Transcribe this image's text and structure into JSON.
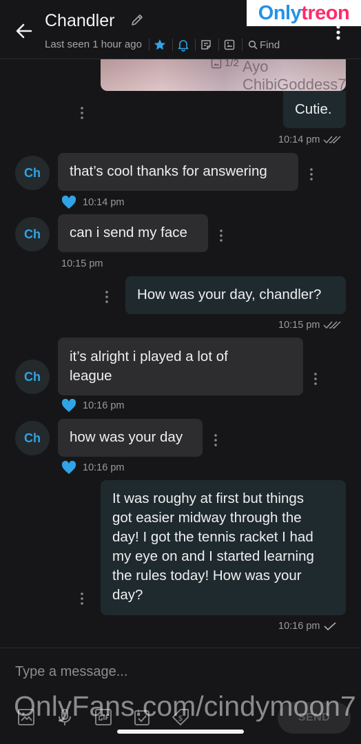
{
  "header": {
    "contact_name": "Chandler",
    "last_seen": "Last seen 1 hour ago",
    "find_label": "Find"
  },
  "watermarks": {
    "top_part1": "Only",
    "top_part2": "treon",
    "bottom": "OnlyFans.com/cindymoon7"
  },
  "colors": {
    "accent": "#2fa4e7",
    "incoming_bubble": "#2d2d2f",
    "outgoing_bubble": "#1f2a2f",
    "background": "#161618"
  },
  "photo": {
    "counter": "1/2",
    "handle": "Ayo ChibiGoddess7"
  },
  "messages": [
    {
      "direction": "out",
      "text": "Cutie.",
      "time": "10:14 pm",
      "status_icon": "double-check-icon"
    },
    {
      "direction": "in",
      "avatar": "Ch",
      "text": "that’s cool thanks for answering",
      "time": "10:14 pm",
      "liked": true
    },
    {
      "direction": "in",
      "avatar": "Ch",
      "text": "can i send my face",
      "time": "10:15 pm",
      "liked": false
    },
    {
      "direction": "out",
      "text": "How was your day, chandler?",
      "time": "10:15 pm",
      "status_icon": "double-check-icon"
    },
    {
      "direction": "in",
      "avatar": "Ch",
      "text_lines": [
        "it’s alright i played a lot of",
        "league"
      ],
      "time": "10:16 pm",
      "liked": true
    },
    {
      "direction": "in",
      "avatar": "Ch",
      "text": "how was your day",
      "time": "10:16 pm",
      "liked": true
    },
    {
      "direction": "out",
      "text_lines": [
        "It was roughy at first but things",
        "got easier midway through the",
        "day! I got the tennis racket I had",
        "my eye on and I started learning",
        "the rules today! How was your",
        "day?"
      ],
      "time": "10:16 pm",
      "status_icon": "check-icon"
    }
  ],
  "composer": {
    "placeholder": "Type a message...",
    "send_label": "SEND",
    "tools": [
      "image-icon",
      "microphone-icon",
      "gif-icon",
      "checklist-icon",
      "price-tag-icon"
    ]
  }
}
